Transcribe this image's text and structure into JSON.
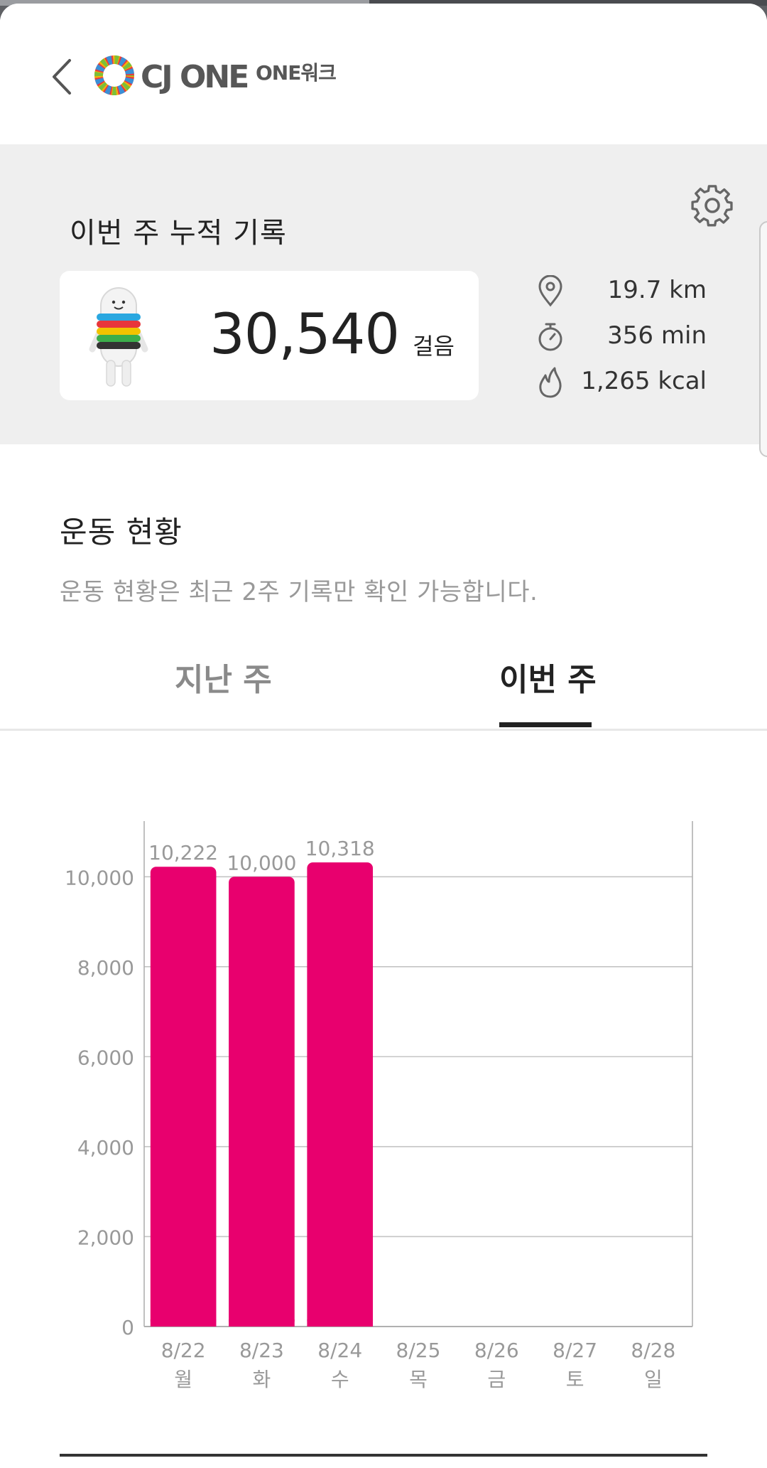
{
  "header": {
    "logo_text": "CJ ONE",
    "logo_sub": "ONE워크"
  },
  "summary": {
    "title": "이번 주 누적 기록",
    "steps": "30,540",
    "steps_unit": "걸음",
    "distance": "19.7 km",
    "duration": "356 min",
    "calories": "1,265 kcal"
  },
  "status": {
    "title": "운동 현황",
    "description": "운동 현황은 최근 2주 기록만 확인 가능합니다."
  },
  "tabs": [
    {
      "label": "지난 주",
      "active": false
    },
    {
      "label": "이번 주",
      "active": true
    }
  ],
  "chart_data": {
    "type": "bar",
    "categories": [
      "8/22",
      "8/23",
      "8/24",
      "8/25",
      "8/26",
      "8/27",
      "8/28"
    ],
    "weekdays": [
      "월",
      "화",
      "수",
      "목",
      "금",
      "토",
      "일"
    ],
    "values": [
      10222,
      10000,
      10318,
      null,
      null,
      null,
      null
    ],
    "value_labels": [
      "10,222",
      "10,000",
      "10,318",
      "",
      "",
      "",
      ""
    ],
    "y_ticks": [
      0,
      2000,
      4000,
      6000,
      8000,
      10000
    ],
    "y_tick_labels": [
      "0",
      "2,000",
      "4,000",
      "6,000",
      "8,000",
      "10,000"
    ],
    "ylim": [
      0,
      11000
    ],
    "grid": true,
    "bar_color": "#e8006e",
    "title": "",
    "xlabel": "",
    "ylabel": ""
  },
  "colors": {
    "accent": "#e8006e",
    "band_background": "#efefef",
    "muted_text": "#999999"
  }
}
